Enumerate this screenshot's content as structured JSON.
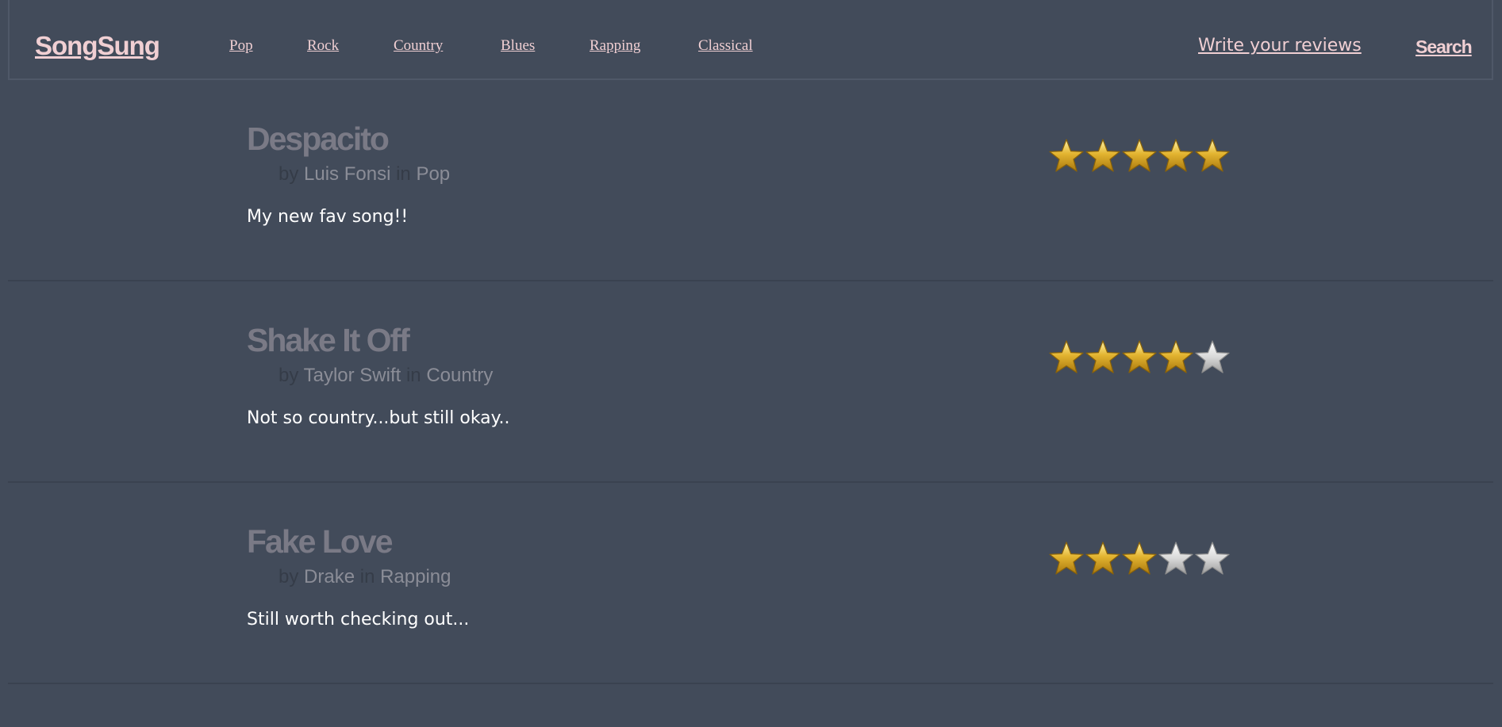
{
  "nav": {
    "brand": "SongSung",
    "genres": [
      "Pop",
      "Rock",
      "Country",
      "Blues",
      "Rapping",
      "Classical"
    ],
    "write_reviews": "Write your reviews",
    "search": "Search"
  },
  "labels": {
    "by": "by",
    "in": "in"
  },
  "reviews": [
    {
      "title": "Despacito",
      "artist": "Luis Fonsi",
      "genre": "Pop",
      "comment": "My new fav song!!",
      "rating": 5,
      "max_rating": 5
    },
    {
      "title": "Shake It Off",
      "artist": "Taylor Swift",
      "genre": "Country",
      "comment": "Not so country...but still okay..",
      "rating": 4,
      "max_rating": 5
    },
    {
      "title": "Fake Love",
      "artist": "Drake",
      "genre": "Rapping",
      "comment": "Still worth checking out...",
      "rating": 3,
      "max_rating": 5
    }
  ],
  "colors": {
    "background": "#424b5a",
    "link": "#f0cfd3",
    "star_filled": "#e3b430",
    "star_empty": "#d9d9d9"
  },
  "icons": {
    "filled": "star-filled-icon",
    "empty": "star-empty-icon"
  }
}
